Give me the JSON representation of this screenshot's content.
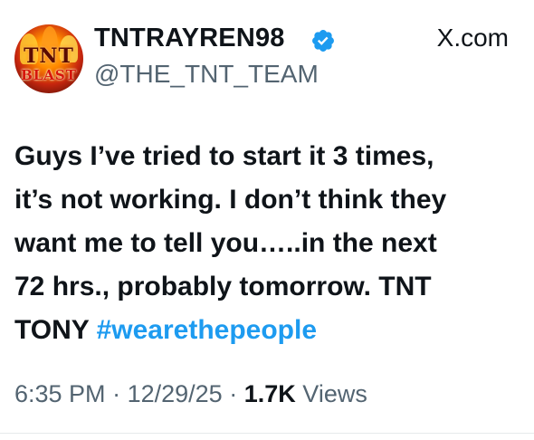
{
  "tweet": {
    "avatar": {
      "logo_top": "TNT",
      "logo_bottom": "BLAST"
    },
    "display_name": "TNTRAYREN98",
    "verified": true,
    "handle": "@THE_TNT_TEAM",
    "source": "X.com",
    "text_lines": [
      "Guys  I’ve tried to start it 3 times,",
      "it’s not working. I don’t think they",
      "want me to tell you…..in the next",
      "72 hrs., probably tomorrow. TNT",
      "TONY "
    ],
    "hashtag": "#wearethepeople",
    "time": "6:35 PM",
    "date": "12/29/25",
    "views_count": "1.7K",
    "views_label": "Views",
    "separator": "·"
  },
  "colors": {
    "text": "#0f1419",
    "secondary": "#536471",
    "accent": "#1d9bf0"
  },
  "icons": {
    "verified": "verified-badge-icon",
    "source": "x-logo-icon"
  }
}
